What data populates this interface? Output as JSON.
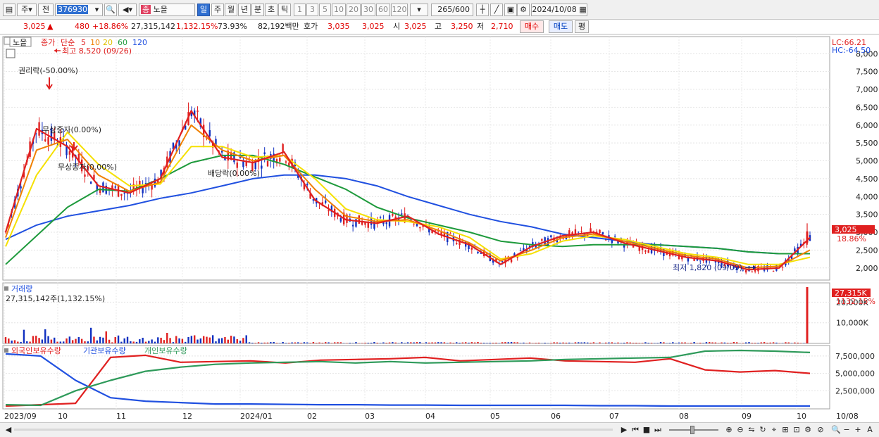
{
  "toolbar": {
    "period_select": "주",
    "prefix": "전",
    "code": "376930",
    "stock_name": "노을",
    "stock_tag": "종",
    "periods": [
      "일",
      "주",
      "월",
      "년",
      "분",
      "초",
      "틱"
    ],
    "intervals": [
      "1",
      "3",
      "5",
      "10",
      "20",
      "30",
      "60",
      "120"
    ],
    "count": "265",
    "count_max": "/600",
    "date": "2024/10/08"
  },
  "info": {
    "price": "3,025",
    "change_arrow": "▲",
    "change": "480",
    "change_pct": "+18.86%",
    "volume": "27,315,142",
    "volume_pct": "1,132.15%",
    "turnover": "73.93%",
    "amount": "82,192백만",
    "bid_label": "호가",
    "bid1": "3,035",
    "bid2": "3,025",
    "open_label": "시",
    "open": "3,025",
    "high_label": "고",
    "high": "3,250",
    "low_label": "저",
    "low": "2,710",
    "buy": "매수",
    "sell": "매도",
    "eval": "평"
  },
  "chart_data": {
    "type": "line",
    "price_panel": {
      "name": "노을",
      "legend": {
        "price": "종가",
        "method": "단순",
        "periods": [
          "5",
          "10",
          "20",
          "60",
          "120"
        ]
      },
      "lc_label": "LC:66.21",
      "hc_label": "HC:-64.50",
      "yticks": [
        "8,000",
        "7,500",
        "7,000",
        "6,500",
        "6,000",
        "5,500",
        "5,000",
        "4,500",
        "4,000",
        "3,500",
        "3,000",
        "2,500",
        "2,000"
      ],
      "ylim": [
        1700,
        8400
      ],
      "current_price": "3,025",
      "current_pct": "18.86%",
      "annotations": {
        "high": "최고 8,520 (09/26)",
        "low": "최저 1,820 (09/09)",
        "rights": "권리락(-50.00%)",
        "bonus1": "무상증자(0.00%)",
        "bonus2": "무상증자(0.00%)",
        "dividend": "배당락(0.00%)"
      },
      "x": [
        "2023/09",
        "10",
        "11",
        "12",
        "2024/01",
        "02",
        "03",
        "04",
        "05",
        "06",
        "07",
        "08",
        "09",
        "10"
      ],
      "series": [
        {
          "name": "5",
          "color": "#e02020",
          "values": [
            3000,
            5900,
            5400,
            4300,
            4100,
            4500,
            6400,
            5100,
            4950,
            5250,
            3900,
            3350,
            3250,
            3450,
            2950,
            2650,
            2100,
            2600,
            2900,
            3000,
            2700,
            2500,
            2300,
            2200,
            1950,
            2000,
            2850
          ]
        },
        {
          "name": "10",
          "color": "#f08000",
          "values": [
            2850,
            5300,
            5600,
            4600,
            4150,
            4400,
            6000,
            5300,
            5000,
            5150,
            4200,
            3450,
            3300,
            3350,
            3050,
            2700,
            2200,
            2500,
            2850,
            2950,
            2750,
            2550,
            2350,
            2250,
            2000,
            2050,
            2500
          ]
        },
        {
          "name": "20",
          "color": "#f5e000",
          "values": [
            2600,
            4600,
            5800,
            4900,
            4300,
            4350,
            5400,
            5400,
            5100,
            5150,
            4500,
            3650,
            3350,
            3300,
            3150,
            2850,
            2250,
            2400,
            2750,
            2900,
            2800,
            2600,
            2400,
            2300,
            2100,
            2100,
            2300
          ]
        },
        {
          "name": "60",
          "color": "#1e9a3c",
          "values": [
            2100,
            2900,
            3700,
            4200,
            4150,
            4500,
            4950,
            5150,
            5150,
            4900,
            4550,
            4200,
            3700,
            3400,
            3200,
            3000,
            2750,
            2650,
            2600,
            2650,
            2650,
            2650,
            2600,
            2550,
            2450,
            2400,
            2400
          ]
        },
        {
          "name": "120",
          "color": "#2050e0",
          "values": [
            2800,
            3200,
            3450,
            3600,
            3750,
            3950,
            4100,
            4300,
            4500,
            4600,
            4600,
            4500,
            4300,
            4000,
            3750,
            3500,
            3300,
            3150,
            2950,
            2850,
            2750,
            2650,
            2600,
            2550,
            2450,
            2400,
            2400
          ]
        }
      ]
    },
    "volume_panel": {
      "title": "거래량",
      "value_text": "27,315,142주(1,132.15%)",
      "yticks": [
        "20,000K",
        "10,000K"
      ],
      "current": "27,315K",
      "current_pct": "1132.15%",
      "ymax": 28000,
      "last_value_k": 27315
    },
    "holders_panel": {
      "legend": [
        "외국인보유수량",
        "기관보유수량",
        "개인보유수량"
      ],
      "colors": [
        "#e02020",
        "#2050e0",
        "#2e9a5a"
      ],
      "yticks": [
        "7,500,000",
        "5,000,000",
        "2,500,000"
      ],
      "ylim": [
        0,
        8500000
      ],
      "series": [
        {
          "name": "외국인보유수량",
          "values": [
            300000,
            500000,
            700000,
            7300000,
            7600000,
            6600000,
            6700000,
            6800000,
            6500000,
            6900000,
            7000000,
            7100000,
            7300000,
            6800000,
            7000000,
            7200000,
            6800000,
            6700000,
            6600000,
            7100000,
            5500000,
            5200000,
            5400000,
            5000000
          ]
        },
        {
          "name": "기관보유수량",
          "values": [
            7800000,
            7500000,
            4000000,
            1500000,
            1000000,
            800000,
            600000,
            600000,
            550000,
            500000,
            500000,
            450000,
            450000,
            400000,
            400000,
            400000,
            400000,
            350000,
            350000,
            300000,
            300000,
            300000,
            300000,
            300000
          ]
        },
        {
          "name": "개인보유수량",
          "values": [
            500000,
            400000,
            2500000,
            4000000,
            5300000,
            5900000,
            6300000,
            6500000,
            6600000,
            6700000,
            6500000,
            6700000,
            6500000,
            6600000,
            6700000,
            6800000,
            7000000,
            7100000,
            7200000,
            7300000,
            8200000,
            8300000,
            8200000,
            8000000
          ]
        }
      ]
    },
    "x_labels": [
      "2023/09",
      "10",
      "11",
      "12",
      "2024/01",
      "02",
      "03",
      "04",
      "05",
      "06",
      "07",
      "08",
      "09",
      "10"
    ],
    "last_date": "10/08"
  }
}
